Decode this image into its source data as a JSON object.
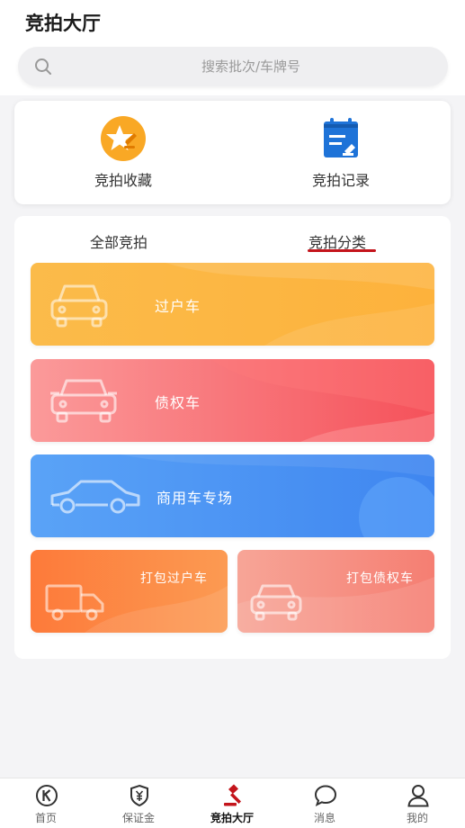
{
  "header": {
    "title": "竞拍大厅"
  },
  "search": {
    "placeholder": "搜索批次/车牌号"
  },
  "quick_links": [
    {
      "label": "竞拍收藏",
      "icon": "star-favorite-icon"
    },
    {
      "label": "竞拍记录",
      "icon": "record-calendar-icon"
    }
  ],
  "tabs": [
    {
      "label": "全部竞拍",
      "active": false
    },
    {
      "label": "竞拍分类",
      "active": true
    }
  ],
  "categories": [
    {
      "label": "过户车",
      "icon": "car-front-icon"
    },
    {
      "label": "债权车",
      "icon": "car-front-icon"
    },
    {
      "label": "商用车专场",
      "icon": "car-side-icon"
    },
    {
      "label": "打包过户车",
      "icon": "truck-icon"
    },
    {
      "label": "打包债权车",
      "icon": "car-front-icon"
    }
  ],
  "bottom_nav": [
    {
      "label": "首页",
      "icon": "home-k-icon",
      "active": false
    },
    {
      "label": "保证金",
      "icon": "deposit-shield-icon",
      "active": false
    },
    {
      "label": "竞拍大厅",
      "icon": "auction-gavel-icon",
      "active": true
    },
    {
      "label": "消息",
      "icon": "message-bubble-icon",
      "active": false
    },
    {
      "label": "我的",
      "icon": "profile-user-icon",
      "active": false
    }
  ],
  "colors": {
    "accent": "#c4141b",
    "orange_card": "#fbb340",
    "red_card": "#f8646b",
    "blue_card": "#4b95f5",
    "deep_orange_card": "#fb8544",
    "salmon_card": "#f88a7e"
  }
}
